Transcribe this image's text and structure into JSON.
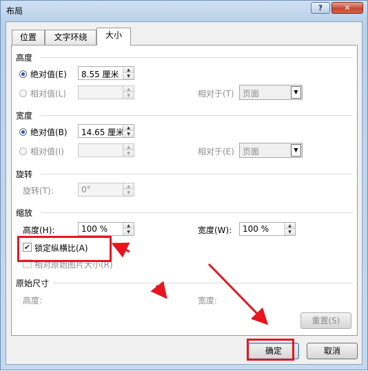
{
  "window": {
    "title": "布局",
    "help_glyph": "?",
    "close_glyph": "✕"
  },
  "tabs": [
    {
      "label": "位置"
    },
    {
      "label": "文字环绕"
    },
    {
      "label": "大小"
    }
  ],
  "height": {
    "section": "高度",
    "absolute_label": "绝对值(E)",
    "absolute_value": "8.55 厘米",
    "relative_label": "相对值(L)",
    "relative_to_label": "相对于(T)",
    "relative_to_value": "页面"
  },
  "width": {
    "section": "宽度",
    "absolute_label": "绝对值(B)",
    "absolute_value": "14.65 厘米",
    "relative_label": "相对值(I)",
    "relative_to_label": "相对于(E)",
    "relative_to_value": "页面"
  },
  "rotate": {
    "section": "旋转",
    "label": "旋转(T):",
    "value": "0°"
  },
  "scale": {
    "section": "缩放",
    "height_label": "高度(H):",
    "height_value": "100 %",
    "width_label": "宽度(W):",
    "width_value": "100 %",
    "lock_aspect_label": "锁定纵横比(A)",
    "lock_aspect_checked": true,
    "relative_original_label": "相对原始图片大小(R)",
    "relative_original_checked": false
  },
  "original": {
    "section": "原始尺寸",
    "height_label": "高度:",
    "width_label": "宽度:"
  },
  "buttons": {
    "reset": "重置(S)",
    "ok": "确定",
    "cancel": "取消"
  },
  "annotation_color": "#e8151f",
  "check_glyph": "✔",
  "icons": {
    "spin_up": "▲",
    "spin_down": "▼",
    "dropdown": "▼"
  }
}
